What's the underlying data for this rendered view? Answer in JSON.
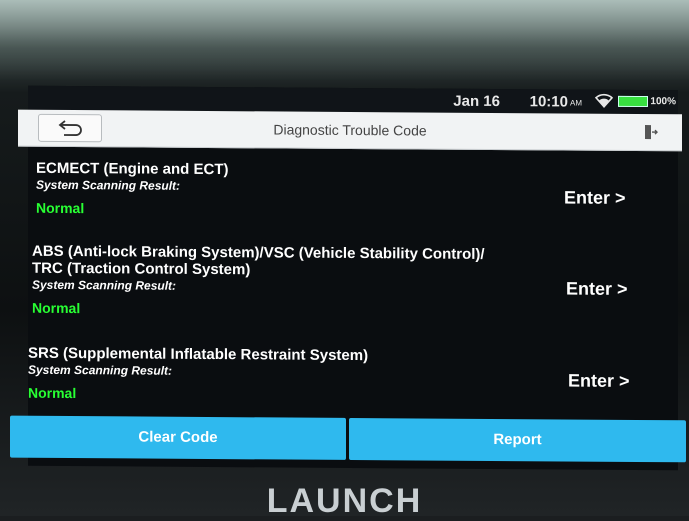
{
  "status_bar": {
    "date": "Jan 16",
    "time": "10:10",
    "ampm": "AM",
    "battery": "100%",
    "wifi_icon": "wifi-icon",
    "battery_icon": "battery-icon"
  },
  "header": {
    "title": "Diagnostic Trouble Code",
    "back_icon": "back-arrow-icon",
    "exit_icon": "exit-icon"
  },
  "systems": [
    {
      "name_lines": [
        "ECMECT (Engine and ECT)"
      ],
      "result_label": "System Scanning Result:",
      "status": "Normal",
      "enter_label": "Enter >"
    },
    {
      "name_lines": [
        "ABS (Anti-lock Braking System)/VSC (Vehicle Stability Control)/",
        "TRC (Traction Control System)"
      ],
      "result_label": "System Scanning Result:",
      "status": "Normal",
      "enter_label": "Enter >"
    },
    {
      "name_lines": [
        "SRS (Supplemental Inflatable Restraint System)"
      ],
      "result_label": "System Scanning Result:",
      "status": "Normal",
      "enter_label": "Enter >"
    }
  ],
  "actions": {
    "clear_code": "Clear Code",
    "report": "Report"
  },
  "brand": "LAUNCH",
  "colors": {
    "status_normal": "#28ff33",
    "action_button": "#2fb9ee",
    "header_bg": "#f1f3f4",
    "screen_bg": "#0a0d10"
  }
}
